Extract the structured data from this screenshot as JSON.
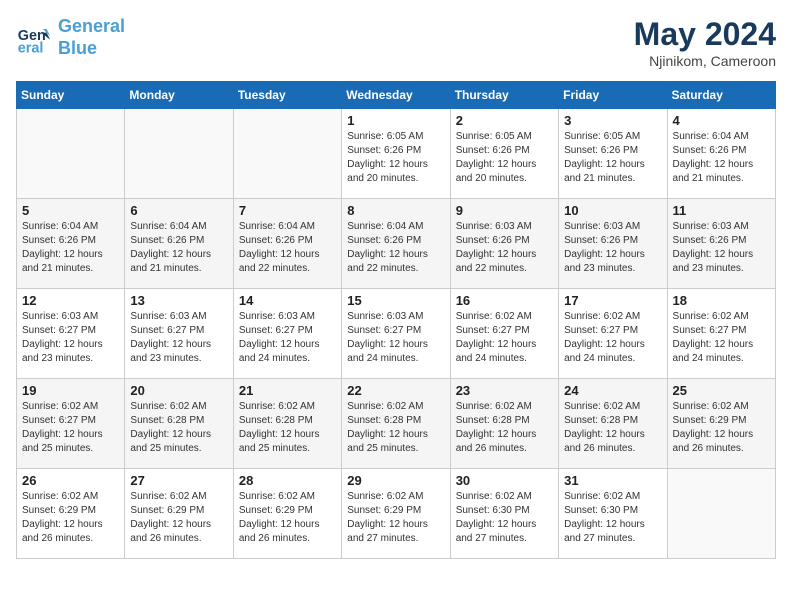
{
  "header": {
    "logo_line1": "General",
    "logo_line2": "Blue",
    "month": "May 2024",
    "location": "Njinikom, Cameroon"
  },
  "weekdays": [
    "Sunday",
    "Monday",
    "Tuesday",
    "Wednesday",
    "Thursday",
    "Friday",
    "Saturday"
  ],
  "weeks": [
    [
      {
        "day": "",
        "info": ""
      },
      {
        "day": "",
        "info": ""
      },
      {
        "day": "",
        "info": ""
      },
      {
        "day": "1",
        "info": "Sunrise: 6:05 AM\nSunset: 6:26 PM\nDaylight: 12 hours\nand 20 minutes."
      },
      {
        "day": "2",
        "info": "Sunrise: 6:05 AM\nSunset: 6:26 PM\nDaylight: 12 hours\nand 20 minutes."
      },
      {
        "day": "3",
        "info": "Sunrise: 6:05 AM\nSunset: 6:26 PM\nDaylight: 12 hours\nand 21 minutes."
      },
      {
        "day": "4",
        "info": "Sunrise: 6:04 AM\nSunset: 6:26 PM\nDaylight: 12 hours\nand 21 minutes."
      }
    ],
    [
      {
        "day": "5",
        "info": "Sunrise: 6:04 AM\nSunset: 6:26 PM\nDaylight: 12 hours\nand 21 minutes."
      },
      {
        "day": "6",
        "info": "Sunrise: 6:04 AM\nSunset: 6:26 PM\nDaylight: 12 hours\nand 21 minutes."
      },
      {
        "day": "7",
        "info": "Sunrise: 6:04 AM\nSunset: 6:26 PM\nDaylight: 12 hours\nand 22 minutes."
      },
      {
        "day": "8",
        "info": "Sunrise: 6:04 AM\nSunset: 6:26 PM\nDaylight: 12 hours\nand 22 minutes."
      },
      {
        "day": "9",
        "info": "Sunrise: 6:03 AM\nSunset: 6:26 PM\nDaylight: 12 hours\nand 22 minutes."
      },
      {
        "day": "10",
        "info": "Sunrise: 6:03 AM\nSunset: 6:26 PM\nDaylight: 12 hours\nand 23 minutes."
      },
      {
        "day": "11",
        "info": "Sunrise: 6:03 AM\nSunset: 6:26 PM\nDaylight: 12 hours\nand 23 minutes."
      }
    ],
    [
      {
        "day": "12",
        "info": "Sunrise: 6:03 AM\nSunset: 6:27 PM\nDaylight: 12 hours\nand 23 minutes."
      },
      {
        "day": "13",
        "info": "Sunrise: 6:03 AM\nSunset: 6:27 PM\nDaylight: 12 hours\nand 23 minutes."
      },
      {
        "day": "14",
        "info": "Sunrise: 6:03 AM\nSunset: 6:27 PM\nDaylight: 12 hours\nand 24 minutes."
      },
      {
        "day": "15",
        "info": "Sunrise: 6:03 AM\nSunset: 6:27 PM\nDaylight: 12 hours\nand 24 minutes."
      },
      {
        "day": "16",
        "info": "Sunrise: 6:02 AM\nSunset: 6:27 PM\nDaylight: 12 hours\nand 24 minutes."
      },
      {
        "day": "17",
        "info": "Sunrise: 6:02 AM\nSunset: 6:27 PM\nDaylight: 12 hours\nand 24 minutes."
      },
      {
        "day": "18",
        "info": "Sunrise: 6:02 AM\nSunset: 6:27 PM\nDaylight: 12 hours\nand 24 minutes."
      }
    ],
    [
      {
        "day": "19",
        "info": "Sunrise: 6:02 AM\nSunset: 6:27 PM\nDaylight: 12 hours\nand 25 minutes."
      },
      {
        "day": "20",
        "info": "Sunrise: 6:02 AM\nSunset: 6:28 PM\nDaylight: 12 hours\nand 25 minutes."
      },
      {
        "day": "21",
        "info": "Sunrise: 6:02 AM\nSunset: 6:28 PM\nDaylight: 12 hours\nand 25 minutes."
      },
      {
        "day": "22",
        "info": "Sunrise: 6:02 AM\nSunset: 6:28 PM\nDaylight: 12 hours\nand 25 minutes."
      },
      {
        "day": "23",
        "info": "Sunrise: 6:02 AM\nSunset: 6:28 PM\nDaylight: 12 hours\nand 26 minutes."
      },
      {
        "day": "24",
        "info": "Sunrise: 6:02 AM\nSunset: 6:28 PM\nDaylight: 12 hours\nand 26 minutes."
      },
      {
        "day": "25",
        "info": "Sunrise: 6:02 AM\nSunset: 6:29 PM\nDaylight: 12 hours\nand 26 minutes."
      }
    ],
    [
      {
        "day": "26",
        "info": "Sunrise: 6:02 AM\nSunset: 6:29 PM\nDaylight: 12 hours\nand 26 minutes."
      },
      {
        "day": "27",
        "info": "Sunrise: 6:02 AM\nSunset: 6:29 PM\nDaylight: 12 hours\nand 26 minutes."
      },
      {
        "day": "28",
        "info": "Sunrise: 6:02 AM\nSunset: 6:29 PM\nDaylight: 12 hours\nand 26 minutes."
      },
      {
        "day": "29",
        "info": "Sunrise: 6:02 AM\nSunset: 6:29 PM\nDaylight: 12 hours\nand 27 minutes."
      },
      {
        "day": "30",
        "info": "Sunrise: 6:02 AM\nSunset: 6:30 PM\nDaylight: 12 hours\nand 27 minutes."
      },
      {
        "day": "31",
        "info": "Sunrise: 6:02 AM\nSunset: 6:30 PM\nDaylight: 12 hours\nand 27 minutes."
      },
      {
        "day": "",
        "info": ""
      }
    ]
  ]
}
